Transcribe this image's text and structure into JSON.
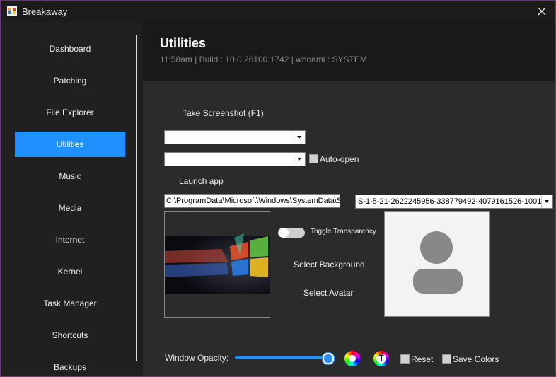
{
  "window": {
    "title": "Breakaway",
    "close_glyph": "✕",
    "accent": "#1e90ff"
  },
  "sidebar": {
    "items": [
      {
        "label": "Dashboard",
        "active": false
      },
      {
        "label": "Patching",
        "active": false
      },
      {
        "label": "File Explorer",
        "active": false
      },
      {
        "label": "Utilities",
        "active": true
      },
      {
        "label": "Music",
        "active": false
      },
      {
        "label": "Media",
        "active": false
      },
      {
        "label": "Internet",
        "active": false
      },
      {
        "label": "Kernel",
        "active": false
      },
      {
        "label": "Task Manager",
        "active": false
      },
      {
        "label": "Shortcuts",
        "active": false
      },
      {
        "label": "Backups",
        "active": false
      }
    ]
  },
  "header": {
    "title": "Utilities",
    "subtitle": "11:58am | Build : 10.0.26100.1742 | whoami : SYSTEM"
  },
  "utilities": {
    "screenshot_label": "Take Screenshot (F1)",
    "combo1_value": "",
    "combo2_value": "",
    "auto_open_label": "Auto-open",
    "auto_open_checked": false,
    "launch_app_label": "Launch app",
    "path_value": "C:\\ProgramData\\Microsoft\\Windows\\SystemData\\S",
    "sid_value": "S-1-5-21-2622245956-338779492-4079161526-1001",
    "toggle_transparency_label": "Toggle Transparency",
    "toggle_transparency_on": false,
    "select_background_label": "Select Background",
    "select_avatar_label": "Select Avatar",
    "window_opacity_label": "Window Opacity:",
    "window_opacity_value": 1.0,
    "text_color_glyph": "T",
    "reset_label": "Reset",
    "reset_checked": false,
    "save_colors_label": "Save Colors",
    "save_colors_checked": false
  }
}
